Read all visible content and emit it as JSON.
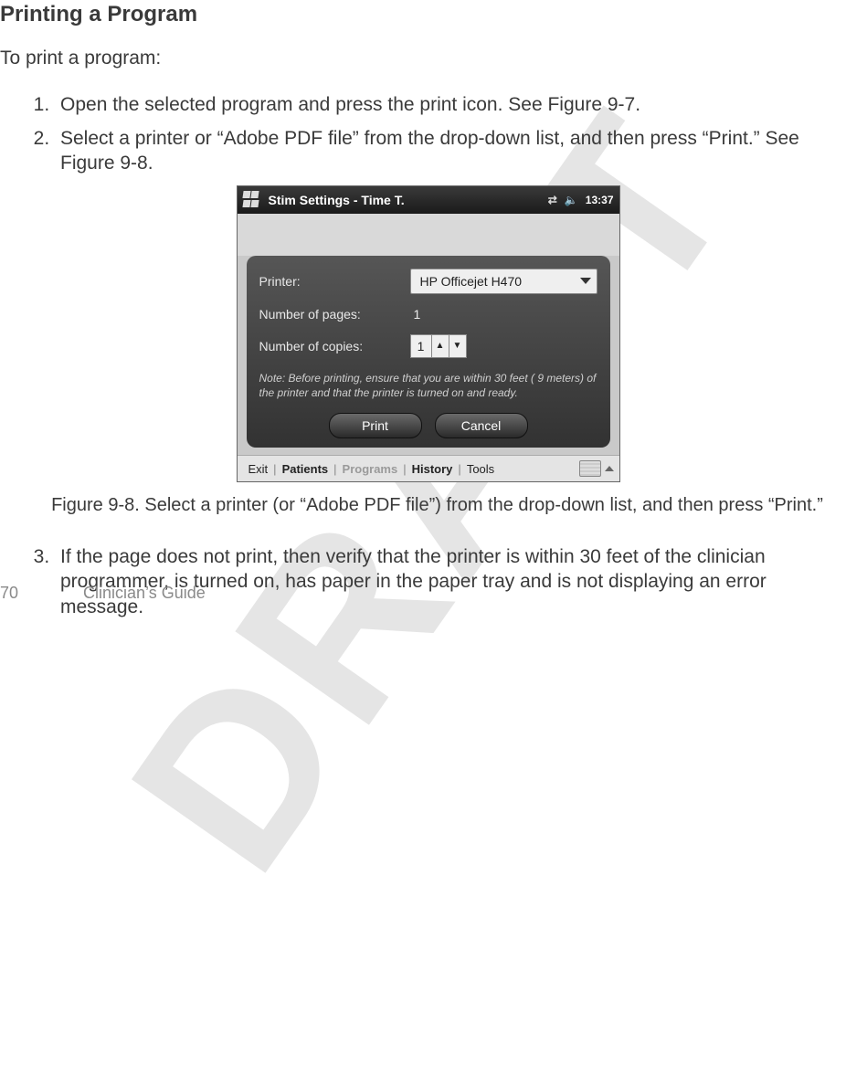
{
  "watermark": "DRAFT",
  "heading": "Printing a Program",
  "intro": "To print a program:",
  "steps_a": [
    "Open the selected program and press the print icon. See Figure 9-7.",
    "Select a printer or “Adobe PDF file” from the drop-down list, and then press “Print.” See Figure 9-8."
  ],
  "figure_caption": "Figure 9-8. Select a printer (or “Adobe PDF file”) from the drop-down list, and then press “Print.”",
  "steps_b": [
    "If the page does not print, then verify that the printer is within 30 feet of the clinician programmer, is turned on, has paper in the paper tray and is not displaying an error message."
  ],
  "footer": {
    "page_number": "70",
    "doc_title": "Clinician’s Guide"
  },
  "device": {
    "titlebar": {
      "title": "Stim Settings - Time T.",
      "clock": "13:37"
    },
    "dialog": {
      "printer_label": "Printer:",
      "printer_value": "HP Officejet H470",
      "pages_label": "Number of pages:",
      "pages_value": "1",
      "copies_label": "Number of copies:",
      "copies_value": "1",
      "note": "Note: Before printing, ensure that you are within 30 feet ( 9 meters) of the  printer and that the printer is turned on and ready.",
      "print_btn": "Print",
      "cancel_btn": "Cancel"
    },
    "bottombar": {
      "exit": "Exit",
      "patients": "Patients",
      "programs": "Programs",
      "history": "History",
      "tools": "Tools"
    }
  }
}
